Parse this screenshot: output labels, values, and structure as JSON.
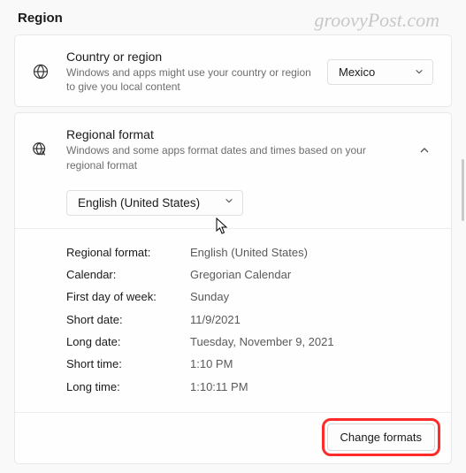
{
  "watermark": "groovyPost.com",
  "page_title": "Region",
  "country_card": {
    "title": "Country or region",
    "desc": "Windows and apps might use your country or region to give you local content",
    "selected": "Mexico"
  },
  "format_card": {
    "title": "Regional format",
    "desc": "Windows and some apps format dates and times based on your regional format",
    "language": "English (United States)",
    "details": [
      {
        "label": "Regional format:",
        "value": "English (United States)"
      },
      {
        "label": "Calendar:",
        "value": "Gregorian Calendar"
      },
      {
        "label": "First day of week:",
        "value": "Sunday"
      },
      {
        "label": "Short date:",
        "value": "11/9/2021"
      },
      {
        "label": "Long date:",
        "value": "Tuesday, November 9, 2021"
      },
      {
        "label": "Short time:",
        "value": "1:10 PM"
      },
      {
        "label": "Long time:",
        "value": "1:10:11 PM"
      }
    ],
    "change_button": "Change formats"
  }
}
